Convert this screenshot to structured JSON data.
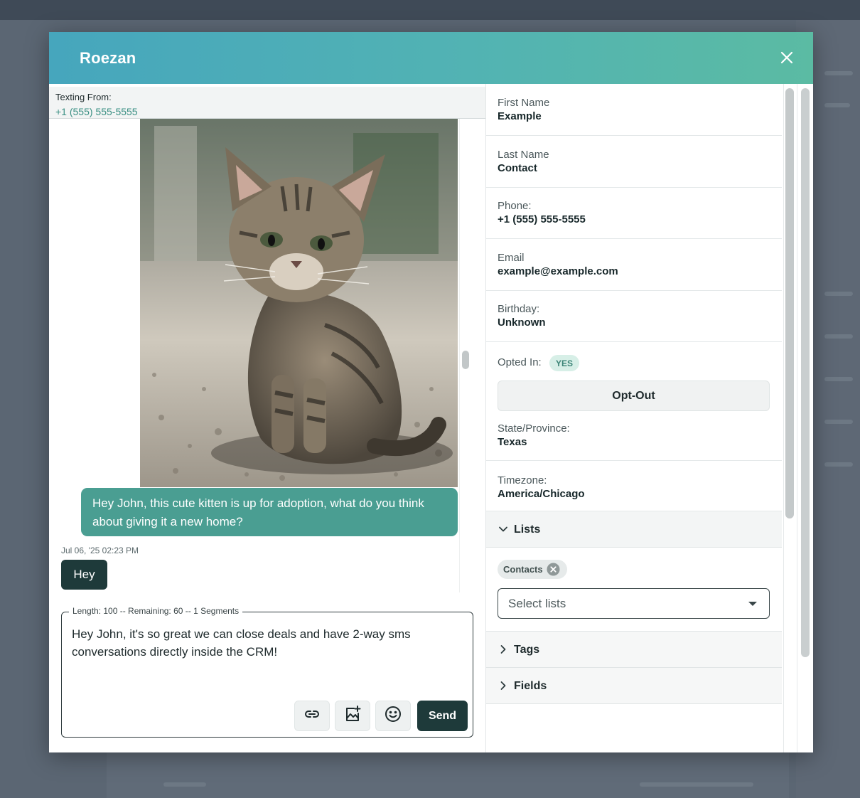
{
  "modal": {
    "title": "Roezan"
  },
  "texting_from": {
    "label": "Texting From:",
    "number": "+1 (555) 555-5555"
  },
  "chat": {
    "image_alt": "kitten photo",
    "outgoing_message": "Hey John, this cute kitten is up for adoption, what do you think about giving it a new home?",
    "timestamp": "Jul 06, '25 02:23 PM",
    "incoming_message": "Hey"
  },
  "composer": {
    "legend": "Length: 100 -- Remaining: 60 -- 1 Segments",
    "text": "Hey John, it's so great we can close deals and have 2-way sms conversations directly inside the CRM!",
    "link_icon": "link-icon",
    "image_icon": "add-image-icon",
    "emoji_icon": "emoji-icon",
    "send_label": "Send"
  },
  "contact": {
    "fields": [
      {
        "label": "First Name",
        "value": "Example"
      },
      {
        "label": "Last Name",
        "value": "Contact"
      },
      {
        "label": "Phone:",
        "value": "+1 (555) 555-5555"
      },
      {
        "label": "Email",
        "value": "example@example.com"
      },
      {
        "label": "Birthday:",
        "value": "Unknown"
      }
    ],
    "opted_in_label": "Opted In:",
    "opted_in_badge": "YES",
    "optout_label": "Opt-Out",
    "state_label": "State/Province:",
    "state_value": "Texas",
    "timezone_label": "Timezone:",
    "timezone_value": "America/Chicago"
  },
  "sections": {
    "lists": {
      "label": "Lists",
      "expanded": true,
      "chips": [
        "Contacts"
      ],
      "select_placeholder": "Select lists"
    },
    "tags": {
      "label": "Tags",
      "expanded": false
    },
    "fields": {
      "label": "Fields",
      "expanded": false
    }
  },
  "colors": {
    "header_gradient_start": "#46a6bd",
    "header_gradient_end": "#5bbba3",
    "outgoing_bubble": "#4a9e92",
    "incoming_bubble": "#1e3a3a",
    "send_button": "#1e3a3a",
    "accent_text": "#3a8f83",
    "badge_bg": "#d7efe7"
  }
}
